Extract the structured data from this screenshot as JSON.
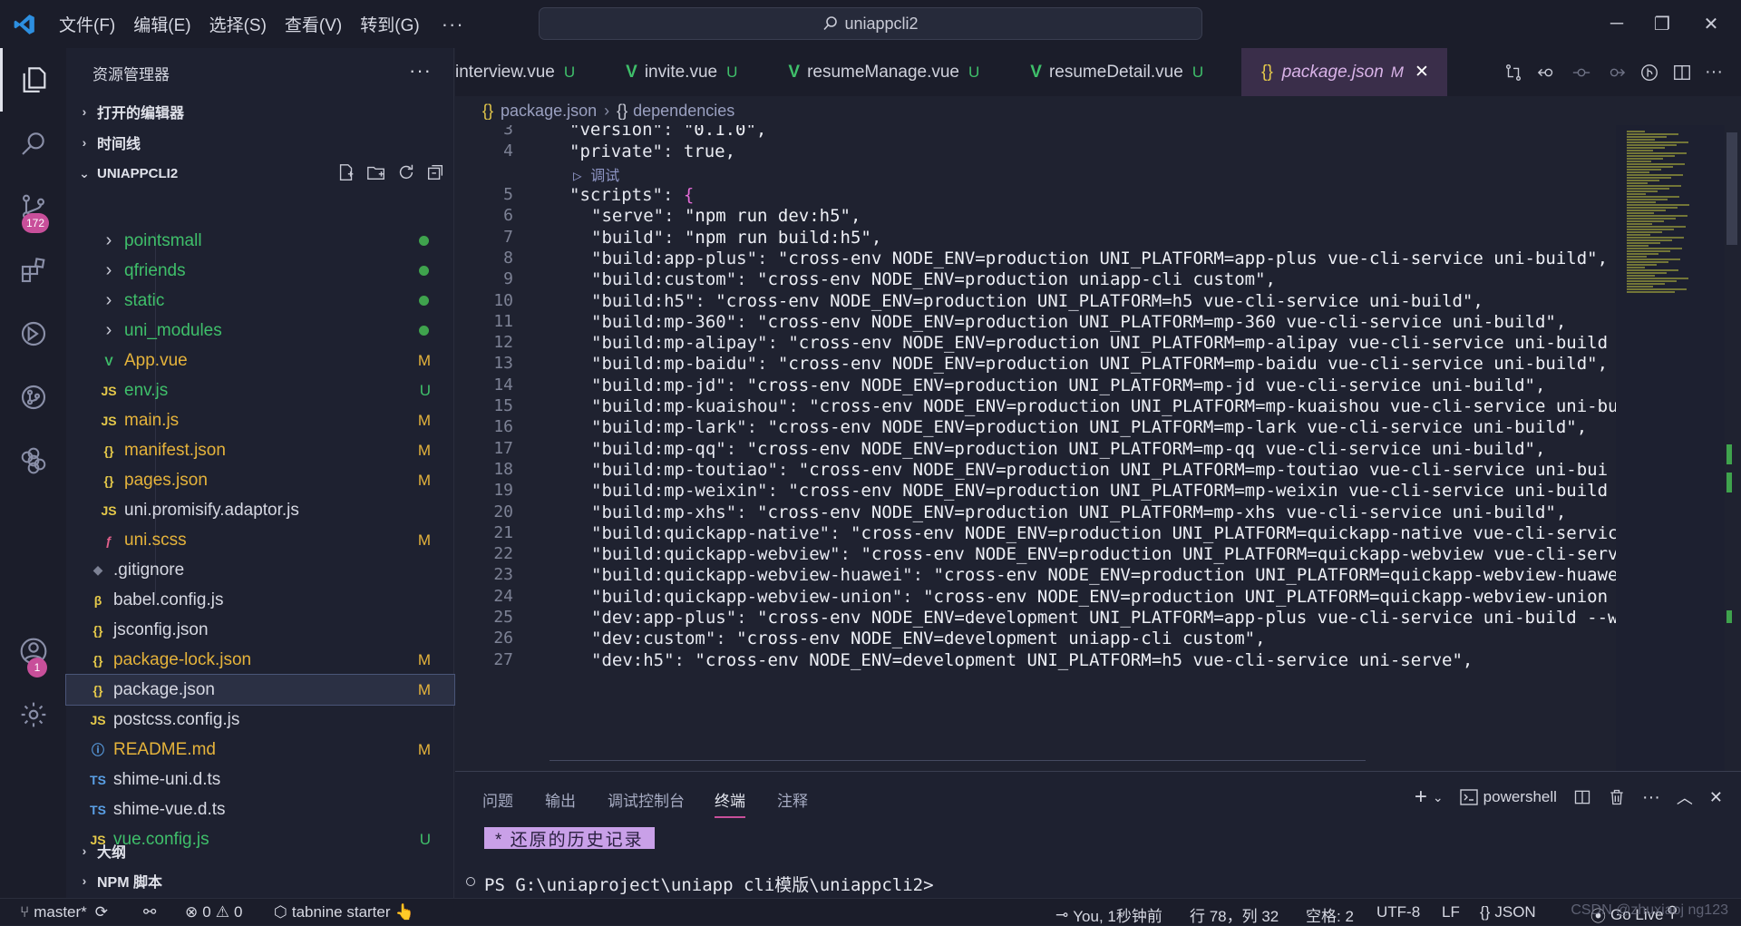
{
  "menu": [
    "文件(F)",
    "编辑(E)",
    "选择(S)",
    "查看(V)",
    "转到(G)"
  ],
  "menu_more": "···",
  "search": {
    "text": "uniappcli2"
  },
  "window_controls": [
    "─",
    "❐",
    "✕"
  ],
  "activity": {
    "source_control_badge": "172",
    "accounts_badge": "1"
  },
  "sidebar": {
    "title": "资源管理器",
    "more": "···",
    "sections": {
      "open_editors": "打开的编辑器",
      "timeline": "时间线",
      "project": "UNIAPPCLI2",
      "outline": "大纲",
      "npm": "NPM 脚本"
    },
    "items": [
      {
        "label": "pointsmall",
        "icon": "›",
        "kind": "folder",
        "status": "dot",
        "color": "#3fbf6a",
        "indent": 1
      },
      {
        "label": "qfriends",
        "icon": "›",
        "kind": "folder",
        "status": "dot",
        "color": "#3fbf6a",
        "indent": 1
      },
      {
        "label": "static",
        "icon": "›",
        "kind": "folder",
        "status": "dot",
        "color": "#3fbf6a",
        "indent": 1
      },
      {
        "label": "uni_modules",
        "icon": "›",
        "kind": "folder",
        "status": "dot",
        "color": "#3fbf6a",
        "indent": 1
      },
      {
        "label": "App.vue",
        "icon": "V",
        "icon_color": "#3fbf6a",
        "status": "M",
        "color": "#e5b33b",
        "indent": 1
      },
      {
        "label": "env.js",
        "icon": "JS",
        "icon_color": "#e5c94a",
        "status": "U",
        "color": "#3fbf6a",
        "indent": 1
      },
      {
        "label": "main.js",
        "icon": "JS",
        "icon_color": "#e5c94a",
        "status": "M",
        "color": "#e5b33b",
        "indent": 1
      },
      {
        "label": "manifest.json",
        "icon": "{}",
        "icon_color": "#e5c94a",
        "status": "M",
        "color": "#e5b33b",
        "indent": 1
      },
      {
        "label": "pages.json",
        "icon": "{}",
        "icon_color": "#e5c94a",
        "status": "M",
        "color": "#e5b33b",
        "indent": 1
      },
      {
        "label": "uni.promisify.adaptor.js",
        "icon": "JS",
        "icon_color": "#e5c94a",
        "status": "",
        "color": "#d6d8e2",
        "indent": 1
      },
      {
        "label": "uni.scss",
        "icon": "ƒ",
        "icon_color": "#e0608a",
        "status": "M",
        "color": "#e5b33b",
        "indent": 1
      },
      {
        "label": ".gitignore",
        "icon": "◆",
        "icon_color": "#7d8295",
        "status": "",
        "color": "#d6d8e2",
        "indent": 0
      },
      {
        "label": "babel.config.js",
        "icon": "β",
        "icon_color": "#e5c94a",
        "status": "",
        "color": "#d6d8e2",
        "indent": 0
      },
      {
        "label": "jsconfig.json",
        "icon": "{}",
        "icon_color": "#e5c94a",
        "status": "",
        "color": "#d6d8e2",
        "indent": 0
      },
      {
        "label": "package-lock.json",
        "icon": "{}",
        "icon_color": "#e5c94a",
        "status": "M",
        "color": "#e5b33b",
        "indent": 0
      },
      {
        "label": "package.json",
        "icon": "{}",
        "icon_color": "#e5c94a",
        "status": "M",
        "color": "#d6d8e2",
        "indent": 0,
        "selected": true
      },
      {
        "label": "postcss.config.js",
        "icon": "JS",
        "icon_color": "#e5c94a",
        "status": "",
        "color": "#d6d8e2",
        "indent": 0
      },
      {
        "label": "README.md",
        "icon": "ⓘ",
        "icon_color": "#5aa0e6",
        "status": "M",
        "color": "#e5b33b",
        "indent": 0
      },
      {
        "label": "shime-uni.d.ts",
        "icon": "TS",
        "icon_color": "#5aa0e6",
        "status": "",
        "color": "#d6d8e2",
        "indent": 0
      },
      {
        "label": "shime-vue.d.ts",
        "icon": "TS",
        "icon_color": "#5aa0e6",
        "status": "",
        "color": "#d6d8e2",
        "indent": 0
      },
      {
        "label": "vue.config.js",
        "icon": "JS",
        "icon_color": "#e5c94a",
        "status": "U",
        "color": "#3fbf6a",
        "indent": 0
      }
    ]
  },
  "tabs": [
    {
      "label": "interview.vue",
      "status": "U"
    },
    {
      "label": "invite.vue",
      "status": "U"
    },
    {
      "label": "resumeManage.vue",
      "status": "U"
    },
    {
      "label": "resumeDetail.vue",
      "status": "U"
    },
    {
      "label": "package.json",
      "status": "M",
      "active": true
    }
  ],
  "breadcrumb": [
    "package.json",
    "dependencies"
  ],
  "codelens": "调试",
  "code": [
    {
      "n": "3",
      "key": "\"version\"",
      "val": "\"0.1.0\","
    },
    {
      "n": "4",
      "key": "\"private\"",
      "val": "true,"
    },
    {
      "n": "5",
      "key": "\"scripts\"",
      "val": "{"
    },
    {
      "n": "6",
      "key": "\"serve\"",
      "val": "\"npm run dev:h5\","
    },
    {
      "n": "7",
      "key": "\"build\"",
      "val": "\"npm run build:h5\","
    },
    {
      "n": "8",
      "key": "\"build:app-plus\"",
      "val": "\"cross-env NODE_ENV=production UNI_PLATFORM=app-plus vue-cli-service uni-build\","
    },
    {
      "n": "9",
      "key": "\"build:custom\"",
      "val": "\"cross-env NODE_ENV=production uniapp-cli custom\","
    },
    {
      "n": "10",
      "key": "\"build:h5\"",
      "val": "\"cross-env NODE_ENV=production UNI_PLATFORM=h5 vue-cli-service uni-build\","
    },
    {
      "n": "11",
      "key": "\"build:mp-360\"",
      "val": "\"cross-env NODE_ENV=production UNI_PLATFORM=mp-360 vue-cli-service uni-build\","
    },
    {
      "n": "12",
      "key": "\"build:mp-alipay\"",
      "val": "\"cross-env NODE_ENV=production UNI_PLATFORM=mp-alipay vue-cli-service uni-build"
    },
    {
      "n": "13",
      "key": "\"build:mp-baidu\"",
      "val": "\"cross-env NODE_ENV=production UNI_PLATFORM=mp-baidu vue-cli-service uni-build\","
    },
    {
      "n": "14",
      "key": "\"build:mp-jd\"",
      "val": "\"cross-env NODE_ENV=production UNI_PLATFORM=mp-jd vue-cli-service uni-build\","
    },
    {
      "n": "15",
      "key": "\"build:mp-kuaishou\"",
      "val": "\"cross-env NODE_ENV=production UNI_PLATFORM=mp-kuaishou vue-cli-service uni-bu"
    },
    {
      "n": "16",
      "key": "\"build:mp-lark\"",
      "val": "\"cross-env NODE_ENV=production UNI_PLATFORM=mp-lark vue-cli-service uni-build\","
    },
    {
      "n": "17",
      "key": "\"build:mp-qq\"",
      "val": "\"cross-env NODE_ENV=production UNI_PLATFORM=mp-qq vue-cli-service uni-build\","
    },
    {
      "n": "18",
      "key": "\"build:mp-toutiao\"",
      "val": "\"cross-env NODE_ENV=production UNI_PLATFORM=mp-toutiao vue-cli-service uni-bui"
    },
    {
      "n": "19",
      "key": "\"build:mp-weixin\"",
      "val": "\"cross-env NODE_ENV=production UNI_PLATFORM=mp-weixin vue-cli-service uni-build"
    },
    {
      "n": "20",
      "key": "\"build:mp-xhs\"",
      "val": "\"cross-env NODE_ENV=production UNI_PLATFORM=mp-xhs vue-cli-service uni-build\","
    },
    {
      "n": "21",
      "key": "\"build:quickapp-native\"",
      "val": "\"cross-env NODE_ENV=production UNI_PLATFORM=quickapp-native vue-cli-servic"
    },
    {
      "n": "22",
      "key": "\"build:quickapp-webview\"",
      "val": "\"cross-env NODE_ENV=production UNI_PLATFORM=quickapp-webview vue-cli-serv"
    },
    {
      "n": "23",
      "key": "\"build:quickapp-webview-huawei\"",
      "val": "\"cross-env NODE_ENV=production UNI_PLATFORM=quickapp-webview-huawe"
    },
    {
      "n": "24",
      "key": "\"build:quickapp-webview-union\"",
      "val": "\"cross-env NODE_ENV=production UNI_PLATFORM=quickapp-webview-union"
    },
    {
      "n": "25",
      "key": "\"dev:app-plus\"",
      "val": "\"cross-env NODE_ENV=development UNI_PLATFORM=app-plus vue-cli-service uni-build --w"
    },
    {
      "n": "26",
      "key": "\"dev:custom\"",
      "val": "\"cross-env NODE_ENV=development uniapp-cli custom\","
    },
    {
      "n": "27",
      "key": "\"dev:h5\"",
      "val": "\"cross-env NODE_ENV=development UNI_PLATFORM=h5 vue-cli-service uni-serve\","
    }
  ],
  "panel": {
    "tabs": [
      "问题",
      "输出",
      "调试控制台",
      "终端",
      "注释"
    ],
    "active_tab": "终端",
    "shell": "powershell",
    "restore": "* 还原的历史记录",
    "prompt": "PS G:\\uniaproject\\uniapp cli模版\\uniappcli2>"
  },
  "status": {
    "branch": "master*",
    "errors": "0",
    "warnings": "0",
    "tabnine": "tabnine starter",
    "blame": "You, 1秒钟前",
    "position": "行 78，列 32",
    "spaces": "空格: 2",
    "encoding": "UTF-8",
    "eol": "LF",
    "language": "JSON",
    "golive": "Go Live",
    "watermark": "CSDN @zhuxiaoj ng123"
  },
  "colors": {
    "accent": "#c84f9a",
    "modified": "#e5b33b",
    "untracked": "#3fbf6a",
    "active_tab_bg": "#3a2e4a"
  }
}
